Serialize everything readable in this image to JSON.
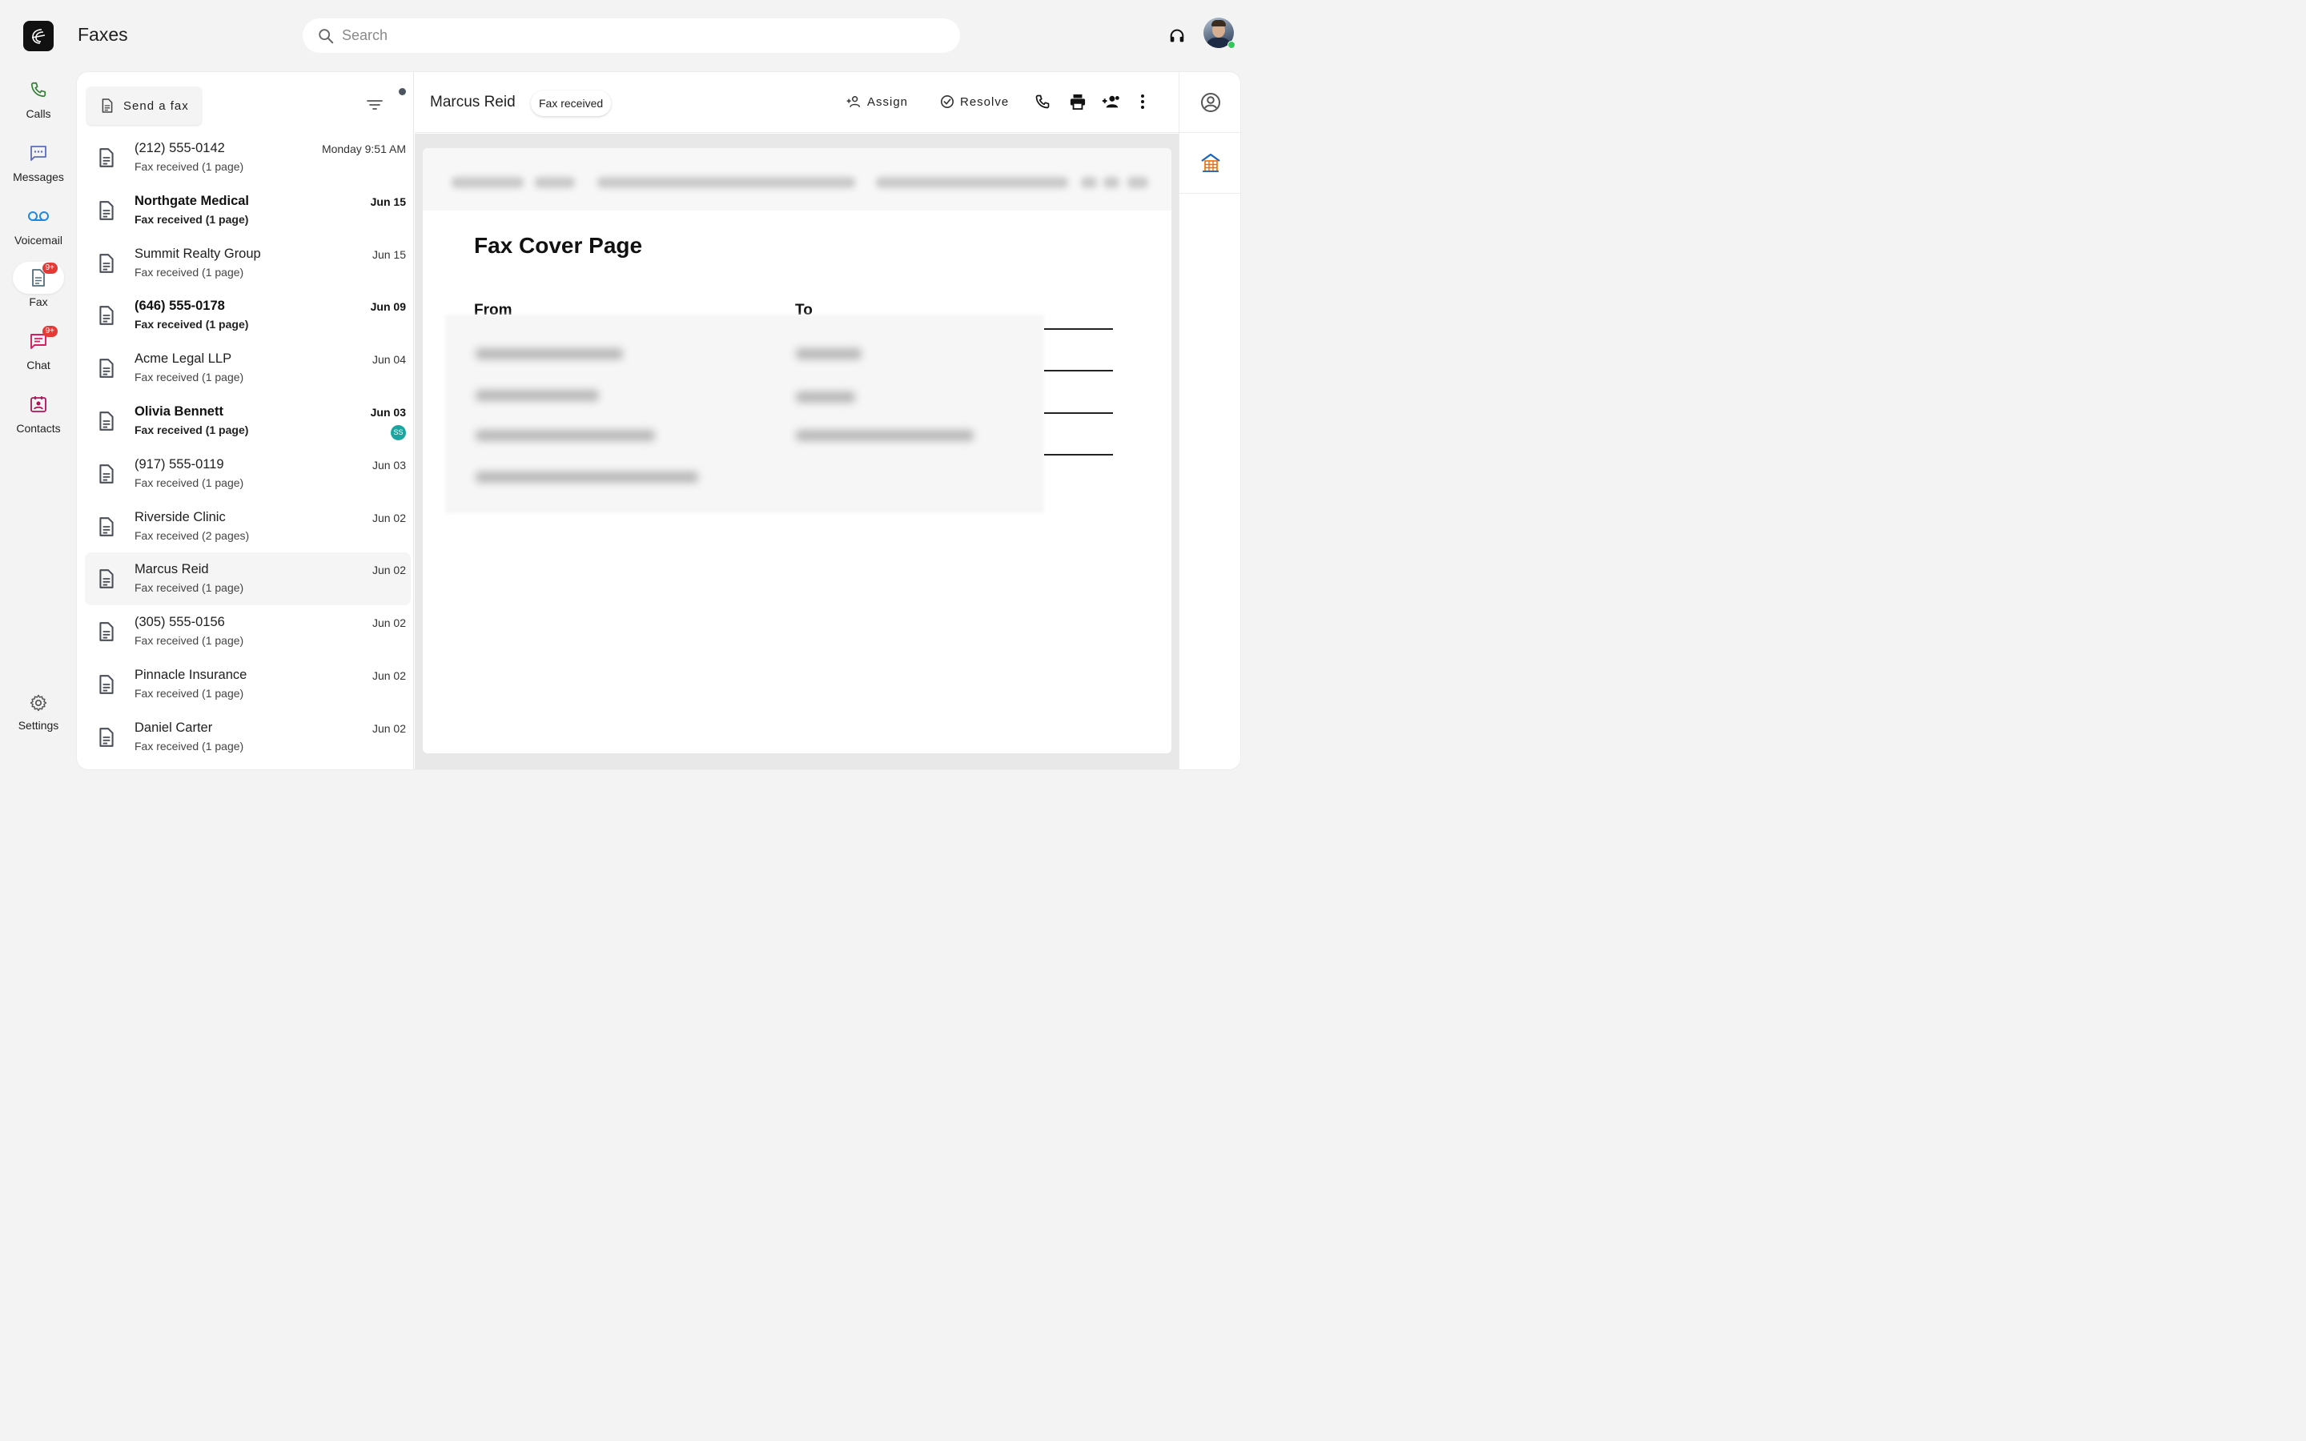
{
  "app": {
    "title": "Faxes",
    "search_placeholder": "Search"
  },
  "nav": [
    {
      "id": "calls",
      "label": "Calls",
      "icon": "phone-icon",
      "color": "#2e7d32"
    },
    {
      "id": "messages",
      "label": "Messages",
      "icon": "chat-bubble-icon",
      "color": "#5c6bc0"
    },
    {
      "id": "voicemail",
      "label": "Voicemail",
      "icon": "voicemail-icon",
      "color": "#1e88e5"
    },
    {
      "id": "fax",
      "label": "Fax",
      "icon": "fax-document-icon",
      "color": "#546e7a",
      "badge": "9+",
      "active": true
    },
    {
      "id": "chat",
      "label": "Chat",
      "icon": "chat-icon",
      "color": "#d81b60",
      "badge": "9+"
    },
    {
      "id": "contacts",
      "label": "Contacts",
      "icon": "contacts-icon",
      "color": "#ad1457"
    }
  ],
  "settings_label": "Settings",
  "list": {
    "send_fax_label": "Send a fax",
    "items": [
      {
        "name": "(212) 555-0142",
        "sub": "Fax received (1 page)",
        "date": "Monday 9:51 AM",
        "unread": false
      },
      {
        "name": "Northgate Medical",
        "sub": "Fax received (1 page)",
        "date": "Jun 15",
        "unread": true
      },
      {
        "name": "Summit Realty Group",
        "sub": "Fax received (1 page)",
        "date": "Jun 15",
        "unread": false
      },
      {
        "name": "(646) 555-0178",
        "sub": "Fax received (1 page)",
        "date": "Jun 09",
        "unread": true
      },
      {
        "name": "Acme Legal LLP",
        "sub": "Fax received (1 page)",
        "date": "Jun 04",
        "unread": false
      },
      {
        "name": "Olivia Bennett",
        "sub": "Fax received (1 page)",
        "date": "Jun 03",
        "unread": true,
        "assignee": "SS"
      },
      {
        "name": "(917) 555-0119",
        "sub": "Fax received (1 page)",
        "date": "Jun 03",
        "unread": false
      },
      {
        "name": "Riverside Clinic",
        "sub": "Fax received (2 pages)",
        "date": "Jun 02",
        "unread": false
      },
      {
        "name": "Marcus Reid",
        "sub": "Fax received (1 page)",
        "date": "Jun 02",
        "unread": false,
        "selected": true
      },
      {
        "name": "(305) 555-0156",
        "sub": "Fax received (1 page)",
        "date": "Jun 02",
        "unread": false
      },
      {
        "name": "Pinnacle Insurance",
        "sub": "Fax received (1 page)",
        "date": "Jun 02",
        "unread": false
      },
      {
        "name": "Daniel Carter",
        "sub": "Fax received (1 page)",
        "date": "Jun 02",
        "unread": false
      }
    ]
  },
  "detail": {
    "contact_name": "Marcus Reid",
    "status_chip": "Fax received",
    "assign_label": "Assign",
    "resolve_label": "Resolve",
    "document": {
      "title": "Fax Cover Page",
      "from_label": "From",
      "to_label": "To"
    }
  },
  "colors": {
    "background": "#f3f3f3",
    "badge": "#e53935",
    "online": "#34c759",
    "assignee_badge": "#1aa6a0"
  }
}
